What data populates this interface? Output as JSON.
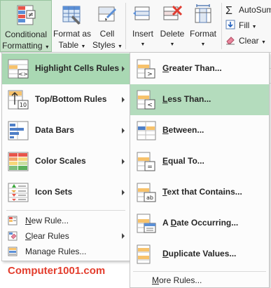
{
  "ribbon": {
    "conditional_formatting": {
      "line1": "Conditional",
      "line2": "Formatting"
    },
    "format_as_table": {
      "line1": "Format as",
      "line2": "Table"
    },
    "cell_styles": {
      "line1": "Cell",
      "line2": "Styles"
    },
    "insert": "Insert",
    "delete": "Delete",
    "format": "Format",
    "autosum": "AutoSum",
    "fill": "Fill",
    "clear": "Clear"
  },
  "menu": {
    "items": [
      {
        "label": "Highlight Cells Rules",
        "icon": "highlight-cells-icon"
      },
      {
        "label": "Top/Bottom Rules",
        "icon": "top-bottom-icon"
      },
      {
        "label": "Data Bars",
        "icon": "data-bars-icon"
      },
      {
        "label": "Color Scales",
        "icon": "color-scales-icon"
      },
      {
        "label": "Icon Sets",
        "icon": "icon-sets-icon"
      }
    ],
    "new_rule": "New Rule...",
    "clear_rules": "Clear Rules",
    "manage_rules": "Manage Rules..."
  },
  "submenu": {
    "items": [
      {
        "label": "Greater Than...",
        "symbol": ">"
      },
      {
        "label": "Less Than...",
        "symbol": "<"
      },
      {
        "label": "Between...",
        "symbol": ""
      },
      {
        "label": "Equal To...",
        "symbol": "="
      },
      {
        "label": "Text that Contains...",
        "symbol": "ab"
      },
      {
        "label": "A Date Occurring...",
        "symbol": ""
      },
      {
        "label": "Duplicate Values...",
        "symbol": ""
      }
    ],
    "more_rules": "More Rules..."
  },
  "watermark": "Computer1001.com",
  "colors": {
    "accent_green": "#a9d8b3",
    "watermark_red": "#e33d2d"
  }
}
